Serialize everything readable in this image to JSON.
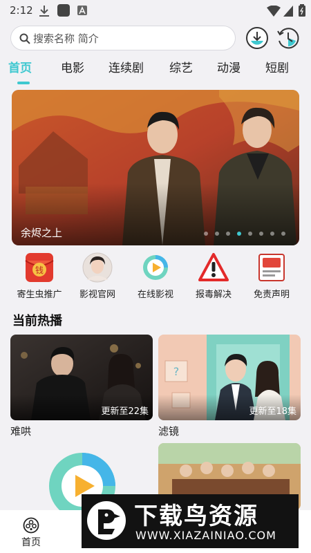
{
  "status_bar": {
    "time": "2:12"
  },
  "search": {
    "placeholder": "搜索名称 简介"
  },
  "tabs": [
    {
      "label": "首页",
      "active": true
    },
    {
      "label": "电影"
    },
    {
      "label": "连续剧"
    },
    {
      "label": "综艺"
    },
    {
      "label": "动漫"
    },
    {
      "label": "短剧"
    }
  ],
  "banner": {
    "caption": "余烬之上",
    "slide_count": 8,
    "active_slide": 4
  },
  "shortcuts": [
    {
      "label": "寄生虫推广",
      "icon": "red-envelope-icon"
    },
    {
      "label": "影视官网",
      "icon": "avatar-icon"
    },
    {
      "label": "在线影视",
      "icon": "play-icon"
    },
    {
      "label": "报毒解决",
      "icon": "warning-icon"
    },
    {
      "label": "免责声明",
      "icon": "notice-icon"
    }
  ],
  "section": {
    "title": "当前热播"
  },
  "cards": [
    {
      "title": "难哄",
      "episode": "更新至22集"
    },
    {
      "title": "滤镜",
      "episode": "更新至18集"
    }
  ],
  "bottom_nav": {
    "home_label": "首页"
  },
  "watermark": {
    "brand": "下载鸟资源",
    "url": "WWW.XIAZAINIAO.COM"
  },
  "colors": {
    "accent": "#3fc8d0",
    "background": "#f2f1f4"
  }
}
